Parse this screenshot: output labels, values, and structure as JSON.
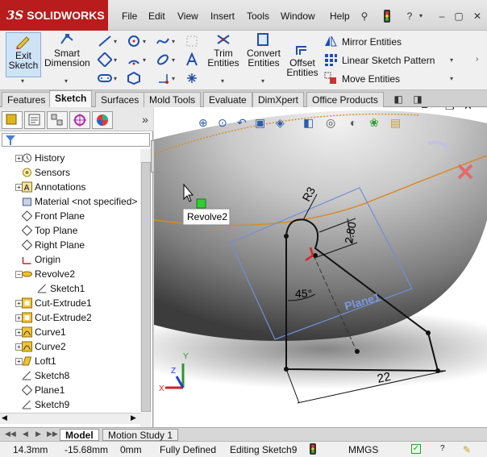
{
  "app": {
    "brand": "SOLIDWORKS",
    "brand_prefix": "3S"
  },
  "menu": [
    "File",
    "Edit",
    "View",
    "Insert",
    "Tools",
    "Window",
    "Help"
  ],
  "command_manager": {
    "exit_sketch": {
      "line1": "Exit",
      "line2": "Sketch"
    },
    "smart_dimension": {
      "line1": "Smart",
      "line2": "Dimension"
    },
    "trim_entities": {
      "line1": "Trim",
      "line2": "Entities"
    },
    "convert_entities": {
      "line1": "Convert",
      "line2": "Entities"
    },
    "offset_entities": {
      "line1": "Offset",
      "line2": "Entities"
    },
    "mirror_entities": "Mirror Entities",
    "linear_sketch_pattern": "Linear Sketch Pattern",
    "move_entities": "Move Entities"
  },
  "tabs": [
    "Features",
    "Sketch",
    "Surfaces",
    "Mold Tools",
    "Evaluate",
    "DimXpert",
    "Office Products"
  ],
  "active_tab": "Sketch",
  "tree": [
    {
      "label": "History",
      "icon": "history-icon",
      "expandable": true
    },
    {
      "label": "Sensors",
      "icon": "sensors-icon",
      "expandable": false
    },
    {
      "label": "Annotations",
      "icon": "annotations-icon",
      "expandable": true
    },
    {
      "label": "Material <not specified>",
      "icon": "material-icon",
      "expandable": false
    },
    {
      "label": "Front Plane",
      "icon": "plane-icon",
      "expandable": false
    },
    {
      "label": "Top Plane",
      "icon": "plane-icon",
      "expandable": false
    },
    {
      "label": "Right Plane",
      "icon": "plane-icon",
      "expandable": false
    },
    {
      "label": "Origin",
      "icon": "origin-icon",
      "expandable": false
    },
    {
      "label": "Revolve2",
      "icon": "revolve-icon",
      "expandable": true,
      "expanded": true
    },
    {
      "label": "Sketch1",
      "icon": "sketch-icon",
      "expandable": false,
      "child": true
    },
    {
      "label": "Cut-Extrude1",
      "icon": "cut-extrude-icon",
      "expandable": true
    },
    {
      "label": "Cut-Extrude2",
      "icon": "cut-extrude-icon",
      "expandable": true
    },
    {
      "label": "Curve1",
      "icon": "curve-icon",
      "expandable": true
    },
    {
      "label": "Curve2",
      "icon": "curve-icon",
      "expandable": true
    },
    {
      "label": "Loft1",
      "icon": "loft-icon",
      "expandable": true
    },
    {
      "label": "Sketch8",
      "icon": "sketch-icon",
      "expandable": false
    },
    {
      "label": "Plane1",
      "icon": "plane-icon",
      "expandable": false
    },
    {
      "label": "Sketch9",
      "icon": "sketch-icon",
      "expandable": false
    }
  ],
  "graphics": {
    "tooltip": "Revolve2",
    "plane_label": "Plane1",
    "dim_radius": "R3",
    "dim_height": "2.80",
    "dim_angle": "45°",
    "dim_width": "22",
    "triad": {
      "x": "X",
      "y": "Y",
      "z": "Z"
    }
  },
  "model_tabs": [
    "Model",
    "Motion Study 1"
  ],
  "active_model_tab": "Model",
  "status": {
    "x": "14.3mm",
    "y": "-15.68mm",
    "z": "0mm",
    "state": "Fully Defined",
    "editing": "Editing Sketch9",
    "units": "MMGS"
  },
  "colors": {
    "brand_red": "#b81c1c",
    "sketch_orange": "#d98a2a",
    "plane_blue": "#6f8fd6",
    "active_tab": "#f7f7f7"
  }
}
